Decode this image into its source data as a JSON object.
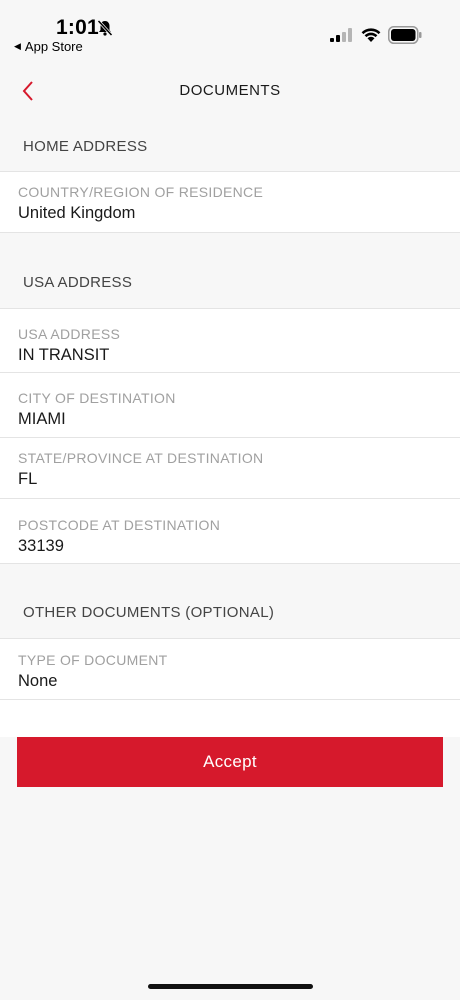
{
  "status_bar": {
    "time": "1:01",
    "back_app_label": "App Store",
    "icons": [
      "bell-slash-icon",
      "signal-icon",
      "wifi-icon",
      "battery-icon"
    ]
  },
  "nav": {
    "title": "DOCUMENTS",
    "back_icon": "chevron-left-icon"
  },
  "sections": {
    "home_address": {
      "header": "HOME ADDRESS",
      "fields": [
        {
          "label": "COUNTRY/REGION OF RESIDENCE",
          "value": "United Kingdom"
        }
      ]
    },
    "usa_address": {
      "header": "USA ADDRESS",
      "fields": [
        {
          "label": "USA ADDRESS",
          "value": "IN TRANSIT"
        },
        {
          "label": "CITY OF DESTINATION",
          "value": "MIAMI"
        },
        {
          "label": "STATE/PROVINCE AT DESTINATION",
          "value": "FL"
        },
        {
          "label": "POSTCODE AT DESTINATION",
          "value": "33139"
        }
      ]
    },
    "other_documents": {
      "header": "OTHER DOCUMENTS (OPTIONAL)",
      "fields": [
        {
          "label": "TYPE OF DOCUMENT",
          "value": "None"
        }
      ]
    }
  },
  "actions": {
    "accept_label": "Accept"
  },
  "colors": {
    "accent": "#d6192c",
    "background": "#f7f7f7",
    "label_gray": "#a0a0a0"
  }
}
